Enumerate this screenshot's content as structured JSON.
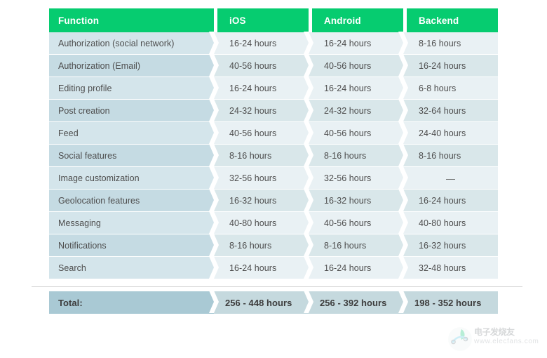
{
  "table": {
    "columns": [
      {
        "key": "function",
        "label": "Function"
      },
      {
        "key": "ios",
        "label": "iOS"
      },
      {
        "key": "android",
        "label": "Android"
      },
      {
        "key": "backend",
        "label": "Backend"
      }
    ],
    "rows": [
      {
        "function": "Authorization (social network)",
        "ios": "16-24 hours",
        "android": "16-24 hours",
        "backend": "8-16 hours"
      },
      {
        "function": "Authorization (Email)",
        "ios": "40-56 hours",
        "android": "40-56 hours",
        "backend": "16-24 hours"
      },
      {
        "function": "Editing profile",
        "ios": "16-24 hours",
        "android": "16-24 hours",
        "backend": "6-8 hours"
      },
      {
        "function": "Post creation",
        "ios": "24-32 hours",
        "android": "24-32 hours",
        "backend": "32-64 hours"
      },
      {
        "function": "Feed",
        "ios": "40-56 hours",
        "android": "40-56 hours",
        "backend": "24-40 hours"
      },
      {
        "function": "Social features",
        "ios": "8-16 hours",
        "android": "8-16 hours",
        "backend": "8-16 hours"
      },
      {
        "function": "Image customization",
        "ios": "32-56 hours",
        "android": "32-56 hours",
        "backend": "—"
      },
      {
        "function": "Geolocation features",
        "ios": "16-32 hours",
        "android": "16-32 hours",
        "backend": "16-24 hours"
      },
      {
        "function": "Messaging",
        "ios": "40-80 hours",
        "android": "40-56 hours",
        "backend": "40-80 hours"
      },
      {
        "function": "Notifications",
        "ios": "8-16 hours",
        "android": "8-16 hours",
        "backend": "16-32 hours"
      },
      {
        "function": "Search",
        "ios": "16-24 hours",
        "android": "16-24 hours",
        "backend": "32-48 hours"
      }
    ],
    "total": {
      "label": "Total:",
      "ios": "256 - 448 hours",
      "android": "256 - 392 hours",
      "backend": "198 - 352 hours"
    }
  },
  "watermark": {
    "brand_cn": "电子发烧友",
    "url": "www.elecfans.com",
    "logo_icon": "elecfans-leaf-logo"
  },
  "colors": {
    "header_green": "#06cc70",
    "func_row_light": "#d4e5eb",
    "func_row_dark": "#c5dbe3",
    "value_row_light": "#e9f1f4",
    "value_row_dark": "#d9e7ea",
    "total_func_bg": "#a9c9d4",
    "total_value_bg": "#c5d9de",
    "text": "#4d4d4d",
    "page_bg": "#ffffff"
  }
}
